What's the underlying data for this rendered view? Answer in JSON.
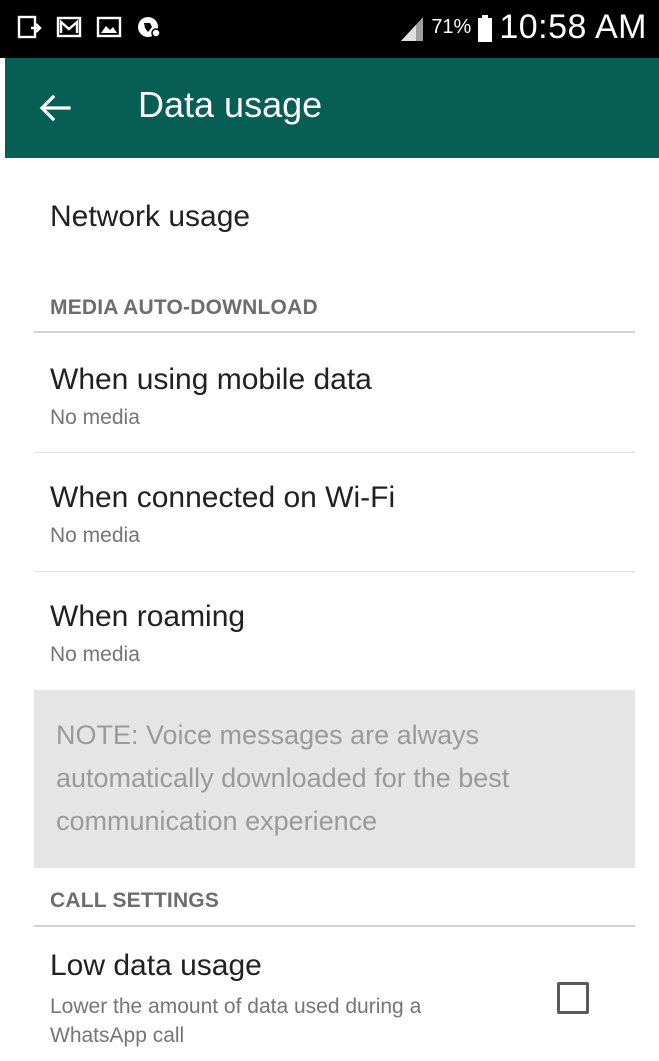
{
  "status_bar": {
    "battery_percent": "71%",
    "time": "10:58 AM",
    "icons": [
      "download-notification-icon",
      "gmail-icon",
      "image-icon",
      "app-notification-icon",
      "signal-icon",
      "battery-icon"
    ]
  },
  "app_bar": {
    "title": "Data usage",
    "back_icon": "arrow-back-icon",
    "color": "#075e54"
  },
  "network_usage": {
    "title": "Network usage"
  },
  "media_auto_download": {
    "header": "MEDIA AUTO-DOWNLOAD",
    "items": [
      {
        "title": "When using mobile data",
        "summary": "No media"
      },
      {
        "title": "When connected on Wi-Fi",
        "summary": "No media"
      },
      {
        "title": "When roaming",
        "summary": "No media"
      }
    ],
    "note": "NOTE: Voice messages are always automatically downloaded for the best communication experience"
  },
  "call_settings": {
    "header": "CALL SETTINGS",
    "low_data": {
      "title": "Low data usage",
      "summary": "Lower the amount of data used during a WhatsApp call",
      "checked": false
    }
  }
}
